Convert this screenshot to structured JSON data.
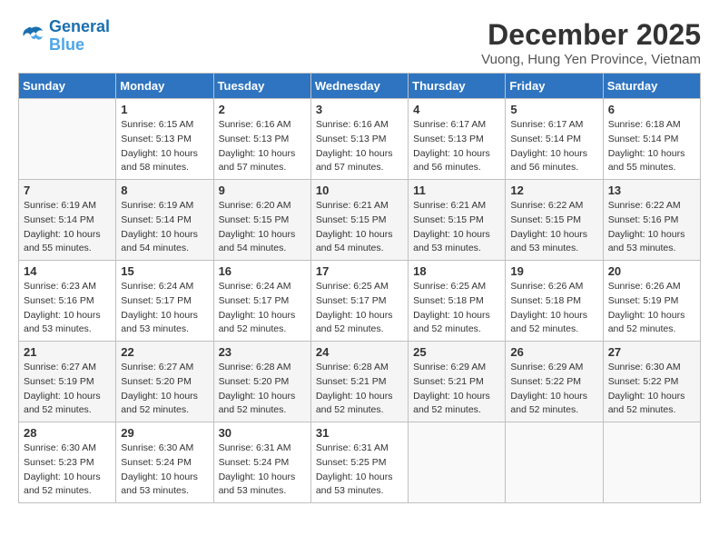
{
  "logo": {
    "line1": "General",
    "line2": "Blue"
  },
  "title": "December 2025",
  "subtitle": "Vuong, Hung Yen Province, Vietnam",
  "weekdays": [
    "Sunday",
    "Monday",
    "Tuesday",
    "Wednesday",
    "Thursday",
    "Friday",
    "Saturday"
  ],
  "weeks": [
    [
      {
        "day": "",
        "sunrise": "",
        "sunset": "",
        "daylight": ""
      },
      {
        "day": "1",
        "sunrise": "6:15 AM",
        "sunset": "5:13 PM",
        "daylight": "10 hours and 58 minutes."
      },
      {
        "day": "2",
        "sunrise": "6:16 AM",
        "sunset": "5:13 PM",
        "daylight": "10 hours and 57 minutes."
      },
      {
        "day": "3",
        "sunrise": "6:16 AM",
        "sunset": "5:13 PM",
        "daylight": "10 hours and 57 minutes."
      },
      {
        "day": "4",
        "sunrise": "6:17 AM",
        "sunset": "5:13 PM",
        "daylight": "10 hours and 56 minutes."
      },
      {
        "day": "5",
        "sunrise": "6:17 AM",
        "sunset": "5:14 PM",
        "daylight": "10 hours and 56 minutes."
      },
      {
        "day": "6",
        "sunrise": "6:18 AM",
        "sunset": "5:14 PM",
        "daylight": "10 hours and 55 minutes."
      }
    ],
    [
      {
        "day": "7",
        "sunrise": "6:19 AM",
        "sunset": "5:14 PM",
        "daylight": "10 hours and 55 minutes."
      },
      {
        "day": "8",
        "sunrise": "6:19 AM",
        "sunset": "5:14 PM",
        "daylight": "10 hours and 54 minutes."
      },
      {
        "day": "9",
        "sunrise": "6:20 AM",
        "sunset": "5:15 PM",
        "daylight": "10 hours and 54 minutes."
      },
      {
        "day": "10",
        "sunrise": "6:21 AM",
        "sunset": "5:15 PM",
        "daylight": "10 hours and 54 minutes."
      },
      {
        "day": "11",
        "sunrise": "6:21 AM",
        "sunset": "5:15 PM",
        "daylight": "10 hours and 53 minutes."
      },
      {
        "day": "12",
        "sunrise": "6:22 AM",
        "sunset": "5:15 PM",
        "daylight": "10 hours and 53 minutes."
      },
      {
        "day": "13",
        "sunrise": "6:22 AM",
        "sunset": "5:16 PM",
        "daylight": "10 hours and 53 minutes."
      }
    ],
    [
      {
        "day": "14",
        "sunrise": "6:23 AM",
        "sunset": "5:16 PM",
        "daylight": "10 hours and 53 minutes."
      },
      {
        "day": "15",
        "sunrise": "6:24 AM",
        "sunset": "5:17 PM",
        "daylight": "10 hours and 53 minutes."
      },
      {
        "day": "16",
        "sunrise": "6:24 AM",
        "sunset": "5:17 PM",
        "daylight": "10 hours and 52 minutes."
      },
      {
        "day": "17",
        "sunrise": "6:25 AM",
        "sunset": "5:17 PM",
        "daylight": "10 hours and 52 minutes."
      },
      {
        "day": "18",
        "sunrise": "6:25 AM",
        "sunset": "5:18 PM",
        "daylight": "10 hours and 52 minutes."
      },
      {
        "day": "19",
        "sunrise": "6:26 AM",
        "sunset": "5:18 PM",
        "daylight": "10 hours and 52 minutes."
      },
      {
        "day": "20",
        "sunrise": "6:26 AM",
        "sunset": "5:19 PM",
        "daylight": "10 hours and 52 minutes."
      }
    ],
    [
      {
        "day": "21",
        "sunrise": "6:27 AM",
        "sunset": "5:19 PM",
        "daylight": "10 hours and 52 minutes."
      },
      {
        "day": "22",
        "sunrise": "6:27 AM",
        "sunset": "5:20 PM",
        "daylight": "10 hours and 52 minutes."
      },
      {
        "day": "23",
        "sunrise": "6:28 AM",
        "sunset": "5:20 PM",
        "daylight": "10 hours and 52 minutes."
      },
      {
        "day": "24",
        "sunrise": "6:28 AM",
        "sunset": "5:21 PM",
        "daylight": "10 hours and 52 minutes."
      },
      {
        "day": "25",
        "sunrise": "6:29 AM",
        "sunset": "5:21 PM",
        "daylight": "10 hours and 52 minutes."
      },
      {
        "day": "26",
        "sunrise": "6:29 AM",
        "sunset": "5:22 PM",
        "daylight": "10 hours and 52 minutes."
      },
      {
        "day": "27",
        "sunrise": "6:30 AM",
        "sunset": "5:22 PM",
        "daylight": "10 hours and 52 minutes."
      }
    ],
    [
      {
        "day": "28",
        "sunrise": "6:30 AM",
        "sunset": "5:23 PM",
        "daylight": "10 hours and 52 minutes."
      },
      {
        "day": "29",
        "sunrise": "6:30 AM",
        "sunset": "5:24 PM",
        "daylight": "10 hours and 53 minutes."
      },
      {
        "day": "30",
        "sunrise": "6:31 AM",
        "sunset": "5:24 PM",
        "daylight": "10 hours and 53 minutes."
      },
      {
        "day": "31",
        "sunrise": "6:31 AM",
        "sunset": "5:25 PM",
        "daylight": "10 hours and 53 minutes."
      },
      {
        "day": "",
        "sunrise": "",
        "sunset": "",
        "daylight": ""
      },
      {
        "day": "",
        "sunrise": "",
        "sunset": "",
        "daylight": ""
      },
      {
        "day": "",
        "sunrise": "",
        "sunset": "",
        "daylight": ""
      }
    ]
  ]
}
